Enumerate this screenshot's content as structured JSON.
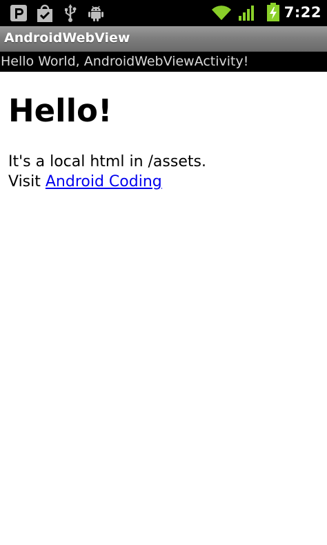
{
  "status_bar": {
    "time": "7:22",
    "left_icons": [
      "p-app-icon",
      "shopping-bag-check-icon",
      "usb-icon",
      "android-debug-icon"
    ],
    "right_icons": [
      "wifi-icon",
      "signal-icon",
      "battery-charging-icon"
    ],
    "accent_color": "#8bd12a"
  },
  "title_bar": {
    "title": "AndroidWebView"
  },
  "text_view": {
    "text": "Hello World, AndroidWebViewActivity!"
  },
  "webview": {
    "heading": "Hello!",
    "line1": "It's a local html in /assets.",
    "visit_label": "Visit ",
    "link_text": "Android Coding",
    "link_color": "#0000ee"
  }
}
